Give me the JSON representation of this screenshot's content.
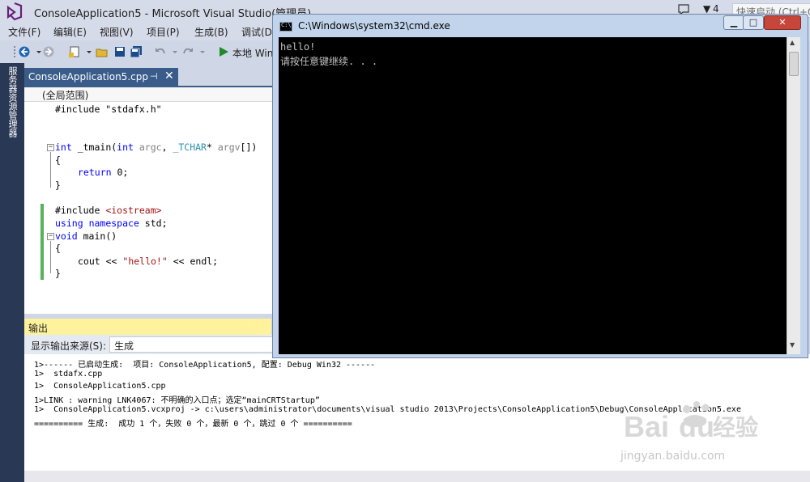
{
  "vs": {
    "title": "ConsoleApplication5 - Microsoft Visual Studio(管理员)",
    "flag_count": "4",
    "quick_launch_placeholder": "快速启动 (Ctrl+Q)",
    "menu": [
      "文件(F)",
      "编辑(E)",
      "视图(V)",
      "项目(P)",
      "生成(B)",
      "调试(D)"
    ],
    "run_label": "本地 Windows 调试器",
    "left_tab": "服务器资源管理器",
    "doc_tab": "ConsoleApplication5.cpp",
    "scope": "(全局范围)"
  },
  "code": {
    "l1": "#include \"stdafx.h\"",
    "l2_kw": "int",
    "l2_fn": " _tmain(",
    "l2_int": "int",
    "l2_argc": " argc",
    "l2_sep": ", ",
    "l2_ty": "_TCHAR",
    "l2_star": "* ",
    "l2_argv": "argv",
    "l2_end": "[])",
    "brace_open": "{",
    "l4_kw": "return",
    "l4_rest": " 0;",
    "brace_close": "}",
    "l6_pre": "#include ",
    "l6_hdr": "<iostream>",
    "l7_kw1": "using",
    "l7_kw2": "namespace",
    "l7_rest": " std;",
    "l8_kw": "void",
    "l8_rest": " main()",
    "l10_a": "cout << ",
    "l10_str": "\"hello!\"",
    "l10_b": " << endl;"
  },
  "output": {
    "header": "输出",
    "source_label": "显示输出来源(S):",
    "source_value": "生成",
    "lines": [
      "1>------ 已启动生成:  项目: ConsoleApplication5, 配置: Debug Win32 ------",
      "1>  stdafx.cpp",
      "1>  ConsoleApplication5.cpp",
      "1>LINK : warning LNK4067: 不明确的入口点；选定“mainCRTStartup”",
      "1>  ConsoleApplication5.vcxproj -> c:\\users\\administrator\\documents\\visual studio 2013\\Projects\\ConsoleApplication5\\Debug\\ConsoleApplication5.exe",
      "========== 生成:  成功 1 个，失败 0 个，最新 0 个，跳过 0 个 =========="
    ]
  },
  "cmd": {
    "title": "C:\\Windows\\system32\\cmd.exe",
    "icon_text": "C:\\",
    "line1": "hello!",
    "line2": "请按任意键继续. . .",
    "btn_min": "▁",
    "btn_max": "□",
    "btn_close": "✕"
  },
  "watermark": {
    "url": "jingyan.baidu.com"
  }
}
